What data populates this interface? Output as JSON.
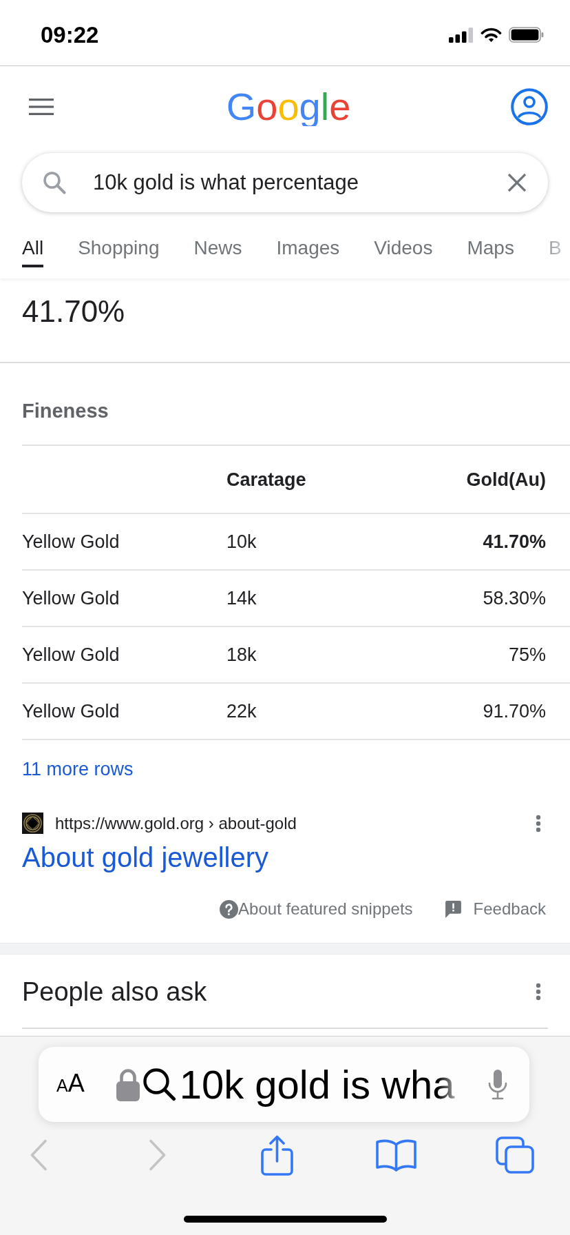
{
  "status_bar": {
    "time": "09:22"
  },
  "header": {
    "logo": "Google"
  },
  "search": {
    "query": "10k gold is what percentage"
  },
  "tabs": [
    {
      "label": "All",
      "selected": true
    },
    {
      "label": "Shopping",
      "selected": false
    },
    {
      "label": "News",
      "selected": false
    },
    {
      "label": "Images",
      "selected": false
    },
    {
      "label": "Videos",
      "selected": false
    },
    {
      "label": "Maps",
      "selected": false
    },
    {
      "label": "B",
      "selected": false
    }
  ],
  "featured_snippet": {
    "answer": "41.70%",
    "table": {
      "title": "Fineness",
      "headings": {
        "column_2": "Caratage",
        "column_3": "Gold(Au)"
      },
      "rows": [
        {
          "cells": [
            "Yellow Gold",
            "10k",
            "41.70%"
          ],
          "highlighted": true
        },
        {
          "cells": [
            "Yellow Gold",
            "14k",
            "58.30%"
          ],
          "highlighted": false
        },
        {
          "cells": [
            "Yellow Gold",
            "18k",
            "75%"
          ],
          "highlighted": false
        },
        {
          "cells": [
            "Yellow Gold",
            "22k",
            "91.70%"
          ],
          "highlighted": false
        }
      ],
      "more_rows": "11 more rows"
    },
    "source": {
      "url": "https://www.gold.org › about-gold",
      "title": "About gold jewellery"
    },
    "footer": {
      "about": "About featured snippets",
      "feedback": "Feedback"
    }
  },
  "people_also_ask": {
    "title": "People also ask"
  },
  "browser_bar": {
    "text_size": "AA",
    "address": "10k gold is wha",
    "toolbar": [
      {
        "kind": "back",
        "disabled": true
      },
      {
        "kind": "forward",
        "disabled": true
      },
      {
        "kind": "share",
        "disabled": false
      },
      {
        "kind": "bookmarks",
        "disabled": false
      },
      {
        "kind": "tabs",
        "disabled": false
      }
    ]
  }
}
